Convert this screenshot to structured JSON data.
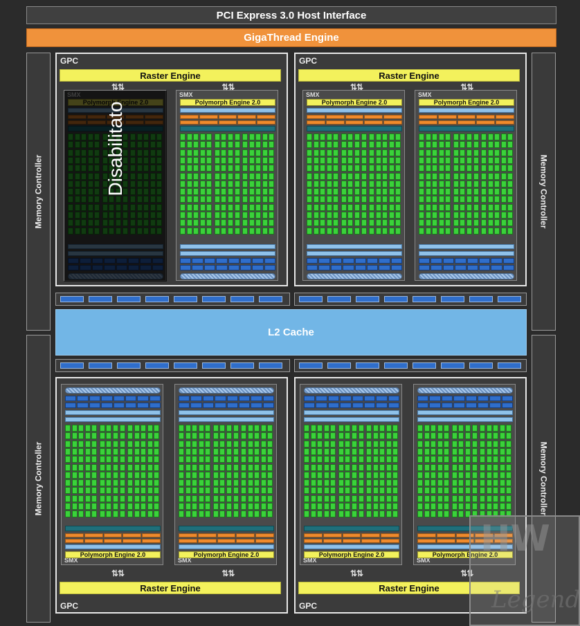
{
  "header": {
    "host_interface": "PCI Express 3.0 Host Interface",
    "gigathread": "GigaThread Engine"
  },
  "memory_controller_label": "Memory Controller",
  "l2_cache": "L2 Cache",
  "gpc_label": "GPC",
  "raster_label": "Raster Engine",
  "smx_label": "SMX",
  "polymorph_label": "Polymorph Engine 2.0",
  "disabled_label": "Disabilitato",
  "arrows": "⇅⇅",
  "watermark": {
    "letters": "HW",
    "word": "Legend"
  },
  "colors": {
    "gigathread": "#f0923b",
    "raster": "#f3f15c",
    "cuda_core": "#3ad23a",
    "l2_cache": "#72b6e6",
    "blue_unit": "#2f6ecb"
  }
}
